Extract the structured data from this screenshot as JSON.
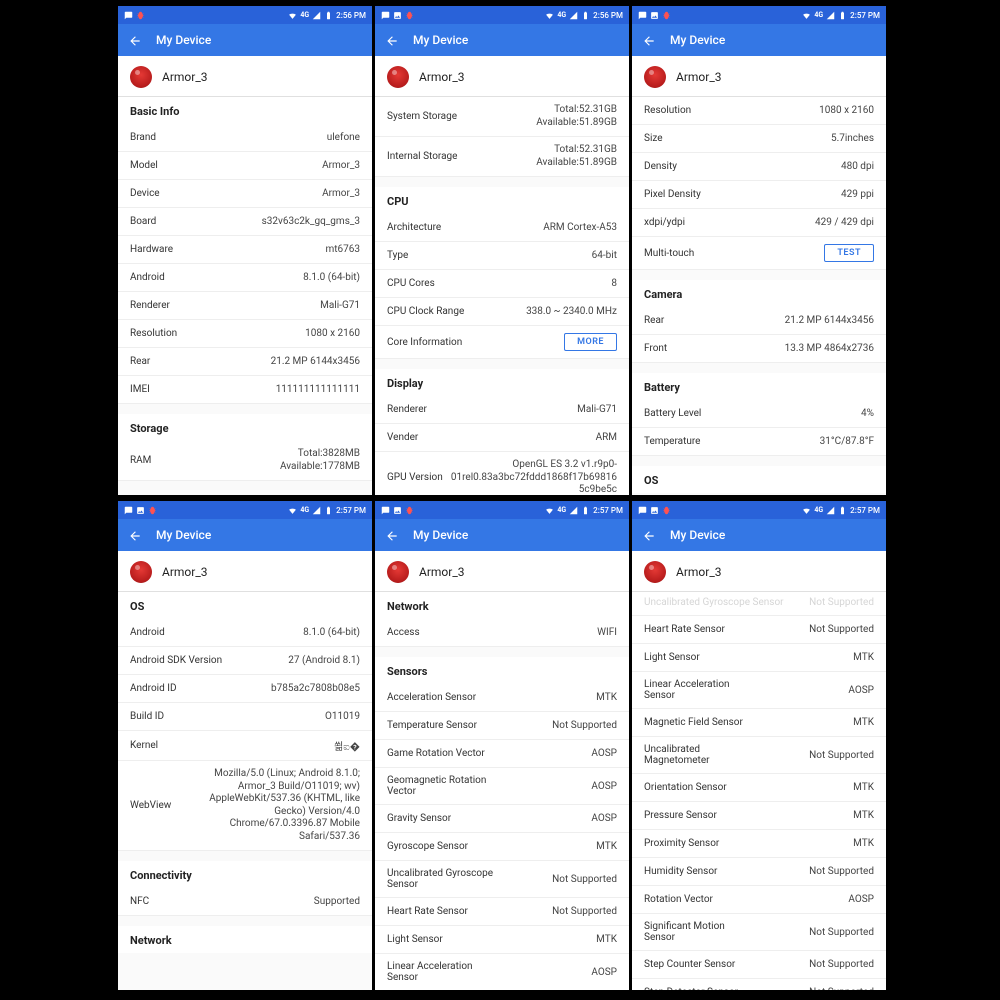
{
  "common": {
    "app_title": "My Device",
    "device_name": "Armor_3",
    "net_label": "4G"
  },
  "screens": [
    {
      "time": "2:56 PM",
      "sb_icons": [
        "msg",
        "bug"
      ],
      "blocks": [
        {
          "type": "header",
          "text": "Basic Info"
        },
        {
          "type": "row",
          "label": "Brand",
          "value": "ulefone"
        },
        {
          "type": "row",
          "label": "Model",
          "value": "Armor_3"
        },
        {
          "type": "row",
          "label": "Device",
          "value": "Armor_3"
        },
        {
          "type": "row",
          "label": "Board",
          "value": "s32v63c2k_gq_gms_3"
        },
        {
          "type": "row",
          "label": "Hardware",
          "value": "mt6763"
        },
        {
          "type": "row",
          "label": "Android",
          "value": "8.1.0 (64-bit)"
        },
        {
          "type": "row",
          "label": "Renderer",
          "value": "Mali-G71"
        },
        {
          "type": "row",
          "label": "Resolution",
          "value": "1080 x 2160"
        },
        {
          "type": "row",
          "label": "Rear",
          "value": "21.2 MP 6144x3456"
        },
        {
          "type": "row",
          "label": "IMEI",
          "value": "111111111111111"
        },
        {
          "type": "gap"
        },
        {
          "type": "header",
          "text": "Storage"
        },
        {
          "type": "row",
          "label": "RAM",
          "value": "Total:3828MB\nAvailable:1778MB",
          "multi": true
        }
      ]
    },
    {
      "time": "2:56 PM",
      "sb_icons": [
        "msg",
        "pic",
        "bug"
      ],
      "blocks": [
        {
          "type": "row",
          "label": "System Storage",
          "value": "Total:52.31GB\nAvailable:51.89GB",
          "multi": true
        },
        {
          "type": "row",
          "label": "Internal Storage",
          "value": "Total:52.31GB\nAvailable:51.89GB",
          "multi": true
        },
        {
          "type": "gap"
        },
        {
          "type": "header",
          "text": "CPU"
        },
        {
          "type": "row",
          "label": "Architecture",
          "value": "ARM Cortex-A53"
        },
        {
          "type": "row",
          "label": "Type",
          "value": "64-bit"
        },
        {
          "type": "row",
          "label": "CPU Cores",
          "value": "8"
        },
        {
          "type": "row",
          "label": "CPU Clock Range",
          "value": "338.0 ~ 2340.0 MHz"
        },
        {
          "type": "row",
          "label": "Core Information",
          "button": "MORE"
        },
        {
          "type": "gap"
        },
        {
          "type": "header",
          "text": "Display"
        },
        {
          "type": "row",
          "label": "Renderer",
          "value": "Mali-G71"
        },
        {
          "type": "row",
          "label": "Vender",
          "value": "ARM"
        },
        {
          "type": "row",
          "label": "GPU Version",
          "value": "OpenGL ES 3.2 v1.r9p0-01rel0.83a3bc72fddd1868f17b698165c9be5c",
          "multi": true
        }
      ]
    },
    {
      "time": "2:57 PM",
      "sb_icons": [
        "msg",
        "pic",
        "bug"
      ],
      "blocks": [
        {
          "type": "row",
          "label": "Resolution",
          "value": "1080 x 2160"
        },
        {
          "type": "row",
          "label": "Size",
          "value": "5.7inches"
        },
        {
          "type": "row",
          "label": "Density",
          "value": "480 dpi"
        },
        {
          "type": "row",
          "label": "Pixel Density",
          "value": "429 ppi"
        },
        {
          "type": "row",
          "label": "xdpi/ydpi",
          "value": "429 / 429 dpi"
        },
        {
          "type": "row",
          "label": "Multi-touch",
          "button": "TEST"
        },
        {
          "type": "gap"
        },
        {
          "type": "header",
          "text": "Camera"
        },
        {
          "type": "row",
          "label": "Rear",
          "value": "21.2 MP 6144x3456"
        },
        {
          "type": "row",
          "label": "Front",
          "value": "13.3 MP 4864x2736"
        },
        {
          "type": "gap"
        },
        {
          "type": "header",
          "text": "Battery"
        },
        {
          "type": "row",
          "label": "Battery Level",
          "value": "4%"
        },
        {
          "type": "row",
          "label": "Temperature",
          "value": "31°C/87.8°F"
        },
        {
          "type": "gap"
        },
        {
          "type": "header",
          "text": "OS"
        }
      ]
    },
    {
      "time": "2:57 PM",
      "sb_icons": [
        "msg",
        "pic",
        "bug"
      ],
      "blocks": [
        {
          "type": "header",
          "text": "OS"
        },
        {
          "type": "row",
          "label": "Android",
          "value": "8.1.0 (64-bit)"
        },
        {
          "type": "row",
          "label": "Android SDK Version",
          "value": "27 (Android 8.1)"
        },
        {
          "type": "row",
          "label": "Android ID",
          "value": "b785a2c7808b08e5"
        },
        {
          "type": "row",
          "label": "Build ID",
          "value": "O11019"
        },
        {
          "type": "row",
          "label": "Kernel",
          "value": "쐶ಐ�"
        },
        {
          "type": "row",
          "label": "WebView",
          "value": "Mozilla/5.0 (Linux; Android 8.1.0; Armor_3 Build/O11019; wv) AppleWebKit/537.36 (KHTML, like Gecko) Version/4.0 Chrome/67.0.3396.87 Mobile Safari/537.36",
          "multi": true
        },
        {
          "type": "gap"
        },
        {
          "type": "header",
          "text": "Connectivity"
        },
        {
          "type": "row",
          "label": "NFC",
          "value": "Supported"
        },
        {
          "type": "gap"
        },
        {
          "type": "header",
          "text": "Network"
        }
      ]
    },
    {
      "time": "2:57 PM",
      "sb_icons": [
        "msg",
        "pic",
        "bug"
      ],
      "blocks": [
        {
          "type": "header",
          "text": "Network"
        },
        {
          "type": "row",
          "label": "Access",
          "value": "WIFI"
        },
        {
          "type": "gap"
        },
        {
          "type": "header",
          "text": "Sensors"
        },
        {
          "type": "row",
          "label": "Acceleration Sensor",
          "value": "MTK"
        },
        {
          "type": "row",
          "label": "Temperature Sensor",
          "value": "Not Supported"
        },
        {
          "type": "row",
          "label": "Game Rotation Vector",
          "value": "AOSP"
        },
        {
          "type": "row",
          "label": "Geomagnetic Rotation Vector",
          "value": "AOSP"
        },
        {
          "type": "row",
          "label": "Gravity Sensor",
          "value": "AOSP"
        },
        {
          "type": "row",
          "label": "Gyroscope Sensor",
          "value": "MTK"
        },
        {
          "type": "row",
          "label": "Uncalibrated Gyroscope Sensor",
          "value": "Not Supported"
        },
        {
          "type": "row",
          "label": "Heart Rate Sensor",
          "value": "Not Supported"
        },
        {
          "type": "row",
          "label": "Light Sensor",
          "value": "MTK"
        },
        {
          "type": "row",
          "label": "Linear Acceleration Sensor",
          "value": "AOSP"
        }
      ]
    },
    {
      "time": "2:57 PM",
      "sb_icons": [
        "msg",
        "pic",
        "bug"
      ],
      "truncated_top": {
        "label": "Uncalibrated Gyroscope Sensor",
        "value": "Not Supported"
      },
      "blocks": [
        {
          "type": "row",
          "label": "Heart Rate Sensor",
          "value": "Not Supported"
        },
        {
          "type": "row",
          "label": "Light Sensor",
          "value": "MTK"
        },
        {
          "type": "row",
          "label": "Linear Acceleration Sensor",
          "value": "AOSP"
        },
        {
          "type": "row",
          "label": "Magnetic Field Sensor",
          "value": "MTK"
        },
        {
          "type": "row",
          "label": "Uncalibrated Magnetometer",
          "value": "Not Supported"
        },
        {
          "type": "row",
          "label": "Orientation Sensor",
          "value": "MTK"
        },
        {
          "type": "row",
          "label": "Pressure Sensor",
          "value": "MTK"
        },
        {
          "type": "row",
          "label": "Proximity Sensor",
          "value": "MTK"
        },
        {
          "type": "row",
          "label": "Humidity Sensor",
          "value": "Not Supported"
        },
        {
          "type": "row",
          "label": "Rotation Vector",
          "value": "AOSP"
        },
        {
          "type": "row",
          "label": "Significant Motion Sensor",
          "value": "Not Supported"
        },
        {
          "type": "row",
          "label": "Step Counter Sensor",
          "value": "Not Supported"
        },
        {
          "type": "row",
          "label": "Step Detector Sensor",
          "value": "Not Supported"
        }
      ]
    }
  ]
}
